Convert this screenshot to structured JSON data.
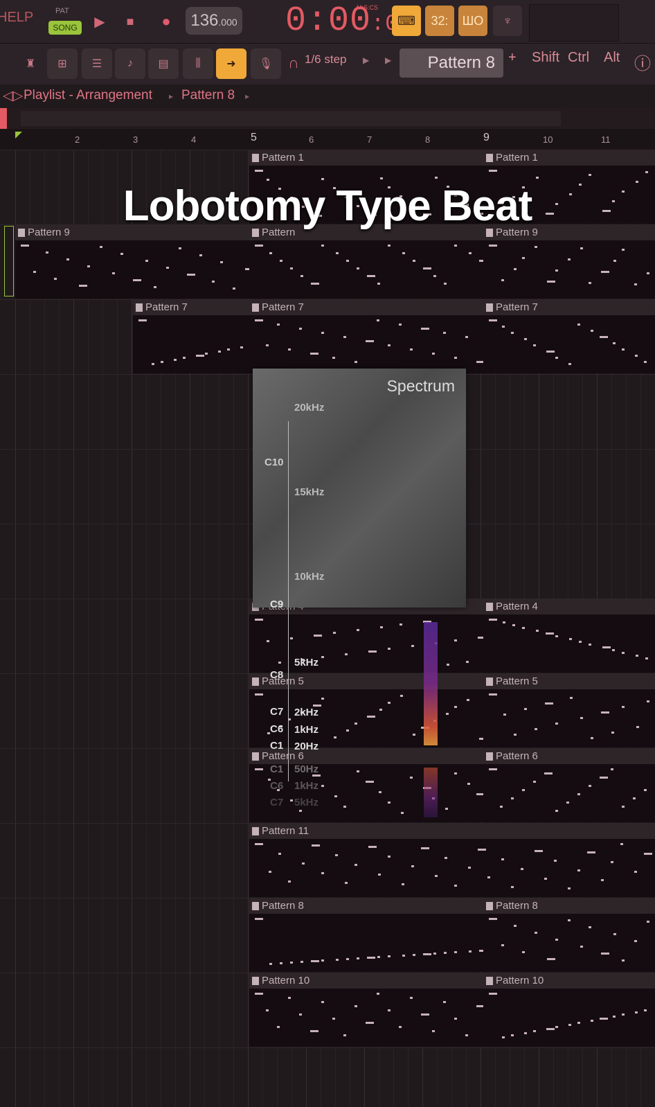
{
  "transport": {
    "help": "HELP",
    "pat_label": "PAT",
    "song_label": "SONG",
    "play_icon": "play-icon",
    "stop_icon": "stop-icon",
    "record_icon": "record-icon",
    "tempo_main": "136",
    "tempo_frac": ".000",
    "time_main": "0:00",
    "time_sub": "00",
    "time_format": "M:S:CS",
    "mode_buttons": [
      "32:",
      "ШO"
    ]
  },
  "toolbar": {
    "step": "1/6 step",
    "pattern": "Pattern 8",
    "plus": "+",
    "shift": "Shift",
    "ctrl": "Ctrl",
    "alt": "Alt"
  },
  "breadcrumb": {
    "title": "Playlist - Arrangement",
    "sep": "▸",
    "pattern": "Pattern 8",
    "sep2": "▸"
  },
  "ruler": [
    "2",
    "3",
    "4",
    "5",
    "6",
    "7",
    "8",
    "9",
    "10",
    "11"
  ],
  "overlay_title": "Lobotomy Type Beat",
  "spectrum": {
    "title": "Spectrum",
    "hz_labels": [
      "20kHz",
      "15kHz",
      "10kHz",
      "5kHz",
      "2kHz",
      "1kHz",
      "20Hz"
    ],
    "note_labels": [
      "C10",
      "C9",
      "C8",
      "C7",
      "C6",
      "C1"
    ],
    "mirror_hz": [
      "50Hz",
      "1kHz",
      "5kHz"
    ],
    "mirror_notes": [
      "C1",
      "C6",
      "C7"
    ]
  },
  "tracks": [
    {
      "clips": [
        "Pattern 1",
        "Pattern 1"
      ]
    },
    {
      "clips": [
        "Pattern 9",
        "Pattern",
        "Pattern 9"
      ]
    },
    {
      "clips": [
        "Pattern 7",
        "Pattern 7",
        "Pattern 7"
      ]
    },
    {
      "clips": []
    },
    {
      "clips": []
    },
    {
      "clips": []
    },
    {
      "clips": [
        "Pattern 4",
        "Pattern 4"
      ]
    },
    {
      "clips": [
        "Pattern 5",
        "Pattern 5"
      ]
    },
    {
      "clips": [
        "Pattern 6",
        "Pattern 6"
      ]
    },
    {
      "clips": [
        "Pattern 11"
      ]
    },
    {
      "clips": [
        "Pattern 8",
        "Pattern 8"
      ]
    },
    {
      "clips": [
        "Pattern 10",
        "Pattern 10"
      ]
    }
  ],
  "colors": {
    "accent": "#e35a64",
    "song": "#9ac43a",
    "orange": "#f0a838"
  }
}
